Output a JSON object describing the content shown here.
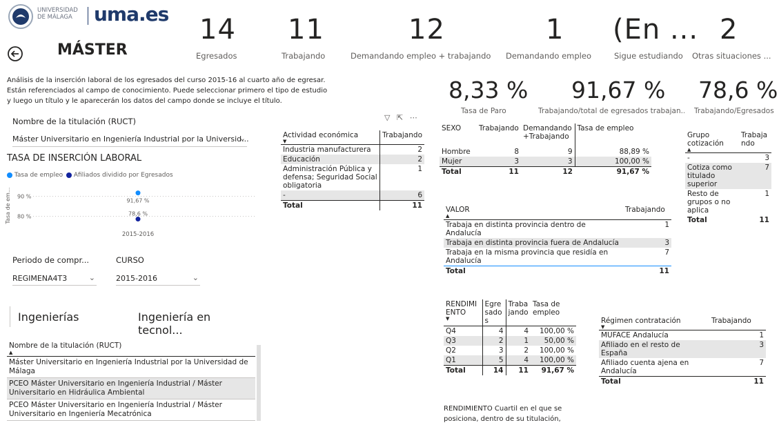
{
  "logo": {
    "univ_line1": "UNIVERSIDAD",
    "univ_line2": "DE MÁLAGA",
    "brand": "uma.es"
  },
  "header": {
    "back_icon": "back-arrow-icon",
    "title": "MÁSTER"
  },
  "kpis": [
    {
      "value": "14",
      "label": "Egresados"
    },
    {
      "value": "11",
      "label": "Trabajando"
    },
    {
      "value": "12",
      "label": "Demandando empleo + trabajando"
    },
    {
      "value": "1",
      "label": "Demandando empleo"
    },
    {
      "value": "(En ...",
      "label": "Sigue estudiando"
    },
    {
      "value": "2",
      "label": "Otras situaciones ..."
    }
  ],
  "description": [
    "Análisis de la inserción laboral de los egresados del curso 2015-16 al cuarto año de egresar.",
    "Están referenciados al campo de conocimiento. Puede seleccionar primero el tipo de estudio",
    "y luego un título y le aparecerán los datos del campo donde se incluye el título."
  ],
  "pct_cards": [
    {
      "value": "8,33 %",
      "label": "Tasa de Paro"
    },
    {
      "value": "91,67 %",
      "label": "Trabajando/total de egresados trabajan..."
    },
    {
      "value": "78,6 %",
      "label": "Trabajando/Egresados"
    }
  ],
  "titulacion_slicer": {
    "label": "Nombre de la titulación (RUCT)",
    "value": "Máster Universitario en Ingeniería Industrial por la Universid..."
  },
  "chart": {
    "title": "TASA DE INSERCIÓN LABORAL",
    "legend": [
      {
        "name": "Tasa de empleo",
        "color": "#118dff"
      },
      {
        "name": "Afiliados dividido por Egresados",
        "color": "#12239e"
      }
    ]
  },
  "chart_data": {
    "type": "scatter",
    "title": "TASA DE INSERCIÓN LABORAL",
    "ylabel": "Tasa de em...",
    "categories": [
      "2015-2016"
    ],
    "y_ticks": [
      "90 %",
      "80 %"
    ],
    "ylim": [
      75,
      95
    ],
    "series": [
      {
        "name": "Tasa de empleo",
        "color": "#118dff",
        "values": [
          91.67
        ],
        "label": "91,67 %"
      },
      {
        "name": "Afiliados dividido por Egresados",
        "color": "#12239e",
        "values": [
          78.6
        ],
        "label": "78,6 %"
      }
    ],
    "grid": true,
    "legend_position": "top-left"
  },
  "periodo": {
    "label": "Periodo de compr...",
    "value": "REGIMENA4T3"
  },
  "curso": {
    "label": "CURSO",
    "value": "2015-2016"
  },
  "campo": {
    "left": "Ingenierías",
    "right": "Ingeniería en tecnol..."
  },
  "titulos_list": {
    "header": "Nombre de la titulación (RUCT)",
    "rows": [
      "Máster Universitario en Ingeniería Industrial por la Universidad de Málaga",
      "PCEO Máster Universitario en Ingeniería Industrial / Máster Universitario en Hidráulica Ambiental",
      "PCEO Máster Universitario en Ingeniería Industrial / Máster Universitario en Ingeniería Mecatrónica"
    ]
  },
  "actividad": {
    "headers": [
      "Actividad económica",
      "Trabajando"
    ],
    "rows": [
      [
        "Industria manufacturera",
        "2"
      ],
      [
        "Educación",
        "2"
      ],
      [
        "Administración Pública y defensa; Seguridad Social obligatoria",
        "1"
      ],
      [
        "-",
        "6"
      ]
    ],
    "total": [
      "Total",
      "11"
    ]
  },
  "sexo": {
    "headers": [
      "SEXO",
      "Trabajando",
      "Demandando +Trabajando",
      "Tasa de empleo"
    ],
    "rows": [
      [
        "Hombre",
        "8",
        "9",
        "88,89 %"
      ],
      [
        "Mujer",
        "3",
        "3",
        "100,00 %"
      ]
    ],
    "total": [
      "Total",
      "11",
      "12",
      "91,67 %"
    ]
  },
  "valor": {
    "headers": [
      "VALOR",
      "Trabajando"
    ],
    "rows": [
      [
        "Trabaja en distinta provincia dentro de Andalucía",
        "1"
      ],
      [
        "Trabaja en distinta provincia fuera de Andalucía",
        "3"
      ],
      [
        "Trabaja en la misma provincia que residía en Andalucía",
        "7"
      ]
    ],
    "total": [
      "Total",
      "11"
    ]
  },
  "grupo": {
    "headers": [
      "Grupo cotización",
      "Trabajando"
    ],
    "rows": [
      [
        "-",
        "3"
      ],
      [
        "Cotiza como titulado superior",
        "7"
      ],
      [
        "Resto de grupos o no aplica",
        "1"
      ]
    ],
    "total": [
      "Total",
      "11"
    ]
  },
  "rendimiento": {
    "headers": [
      "RENDIMIENTO",
      "Egresados",
      "Trabajando",
      "Tasa de empleo"
    ],
    "rows": [
      [
        "Q4",
        "4",
        "4",
        "100,00 %"
      ],
      [
        "Q3",
        "2",
        "1",
        "50,00 %"
      ],
      [
        "Q2",
        "3",
        "2",
        "100,00 %"
      ],
      [
        "Q1",
        "5",
        "4",
        "100,00 %"
      ]
    ],
    "total": [
      "Total",
      "14",
      "11",
      "91,67 %"
    ],
    "note": "RENDIMIENTO Cuartil en el que se posiciona, dentro de su titulación, la"
  },
  "regimen": {
    "headers": [
      "Régimen contratación",
      "Trabajando"
    ],
    "rows": [
      [
        "MUFACE Andalucía",
        "1"
      ],
      [
        "Afiliado en el resto de España",
        "3"
      ],
      [
        "Afiliado cuenta ajena en Andalucía",
        "7"
      ]
    ],
    "total": [
      "Total",
      "11"
    ]
  }
}
